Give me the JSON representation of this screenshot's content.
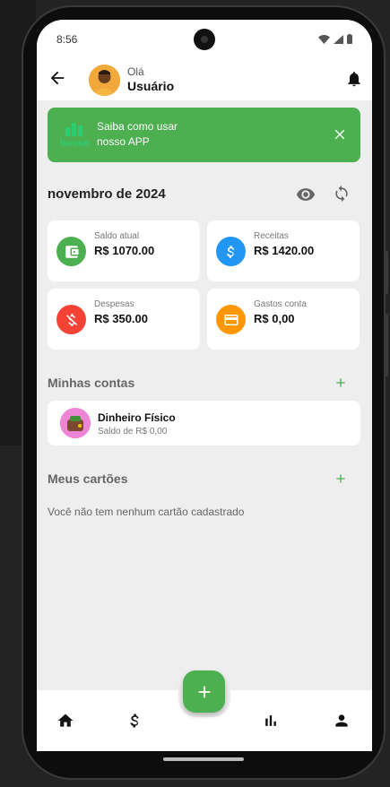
{
  "status_bar": {
    "time": "8:56"
  },
  "header": {
    "greeting": "Olá",
    "username": "Usuário"
  },
  "banner": {
    "logo_text": "house",
    "line1": "Saiba como usar",
    "line2": "nosso APP"
  },
  "period": {
    "month_label": "novembro de 2024"
  },
  "summary_cards": [
    {
      "label": "Saldo atual",
      "value": "R$ 1070.00",
      "icon": "wallet-icon",
      "color": "#4caf50"
    },
    {
      "label": "Receitas",
      "value": "R$ 1420.00",
      "icon": "dollar-icon",
      "color": "#2196f3"
    },
    {
      "label": "Despesas",
      "value": "R$ 350.00",
      "icon": "money-off-icon",
      "color": "#f44336"
    },
    {
      "label": "Gastos conta",
      "value": "R$ 0,00",
      "icon": "credit-card-icon",
      "color": "#ff9800"
    }
  ],
  "accounts": {
    "title": "Minhas contas",
    "items": [
      {
        "name": "Dinheiro Físico",
        "balance": "Saldo de R$ 0,00"
      }
    ]
  },
  "cards": {
    "title": "Meus cartões",
    "empty_message": "Você não tem nenhum cartão cadastrado"
  },
  "colors": {
    "accent": "#4caf50",
    "background": "#eeeeee"
  },
  "bottom_nav": [
    "home-icon",
    "dollar-icon",
    "bar-chart-icon",
    "person-icon"
  ]
}
